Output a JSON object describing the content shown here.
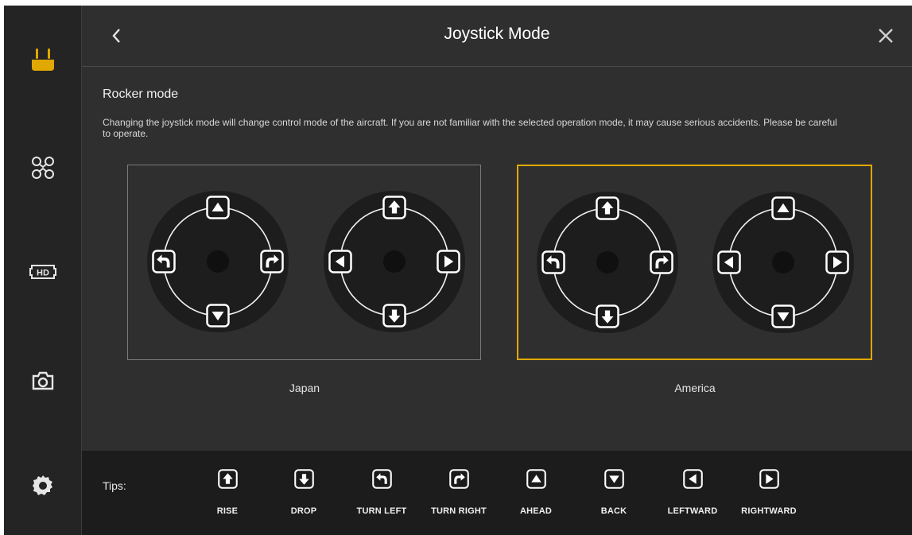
{
  "header": {
    "title": "Joystick Mode",
    "back_icon": "chevron-left-icon",
    "close_icon": "close-icon"
  },
  "sidebar": {
    "items": [
      {
        "name": "remote-controller",
        "icon": "remote-controller-icon",
        "active": true
      },
      {
        "name": "aircraft",
        "icon": "drone-icon",
        "active": false
      },
      {
        "name": "image-transmission",
        "icon": "hd-icon",
        "active": false
      },
      {
        "name": "camera",
        "icon": "camera-icon",
        "active": false
      },
      {
        "name": "settings",
        "icon": "gear-icon",
        "active": false
      }
    ]
  },
  "rocker": {
    "section_title": "Rocker mode",
    "warning": "Changing the joystick mode will change control mode of the aircraft. If you are not familiar with the selected operation mode, it may cause serious accidents. Please be careful to operate.",
    "modes": [
      {
        "label": "Japan",
        "selected": false,
        "left_stick": [
          "ahead",
          "turn-left",
          "turn-right",
          "back"
        ],
        "right_stick": [
          "rise",
          "leftward",
          "rightward",
          "drop"
        ]
      },
      {
        "label": "America",
        "selected": true,
        "left_stick": [
          "rise",
          "turn-left",
          "turn-right",
          "drop"
        ],
        "right_stick": [
          "ahead",
          "leftward",
          "rightward",
          "back"
        ]
      }
    ]
  },
  "tips": {
    "label": "Tips:",
    "items": [
      {
        "label": "RISE",
        "icon": "rise"
      },
      {
        "label": "DROP",
        "icon": "drop"
      },
      {
        "label": "TURN LEFT",
        "icon": "turn-left"
      },
      {
        "label": "TURN RIGHT",
        "icon": "turn-right"
      },
      {
        "label": "AHEAD",
        "icon": "ahead"
      },
      {
        "label": "BACK",
        "icon": "back"
      },
      {
        "label": "LEFTWARD",
        "icon": "leftward"
      },
      {
        "label": "RIGHTWARD",
        "icon": "rightward"
      }
    ]
  },
  "colors": {
    "accent": "#e0a800",
    "background": "#2f2f2f",
    "sidebar": "#242424",
    "tips_bar": "#1c1c1c"
  }
}
